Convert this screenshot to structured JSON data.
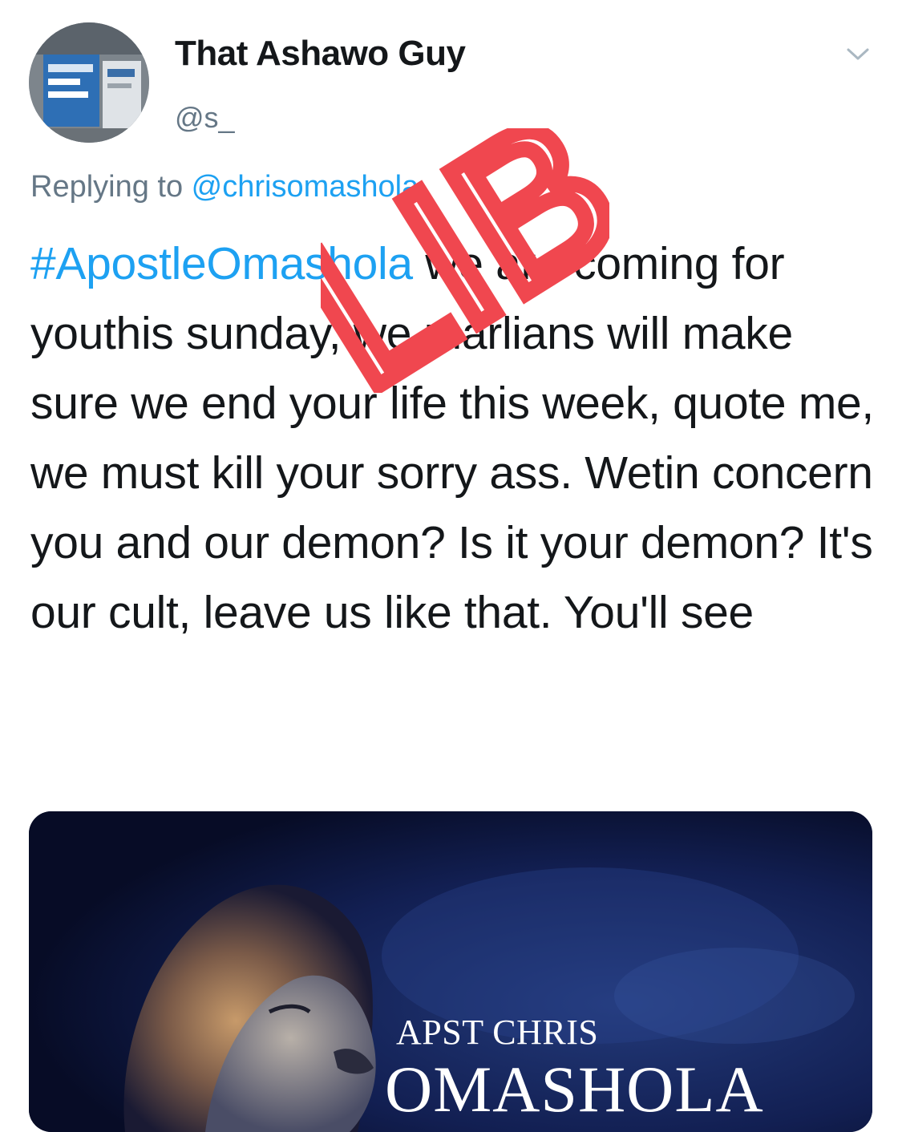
{
  "author": {
    "display_name": "That Ashawo Guy",
    "handle": "@s_",
    "avatar_icon": "profile-photo-icon"
  },
  "menu_icon": "chevron-down-icon",
  "reply": {
    "prefix": "Replying to ",
    "mention": "@chrisomashola"
  },
  "body": {
    "hashtag": "#ApostleOmashola",
    "text": " we are coming for youthis sunday, we marlians will make sure we end your life this week, quote me, we must kill your sorry ass. Wetin concern you and our demon? Is it your demon? It's our cult, leave us like that. You'll see"
  },
  "watermark": {
    "text": "LIB",
    "color": "#f0474f"
  },
  "media": {
    "subtitle": "APST CHRIS",
    "title": "OMASHOLA",
    "image_icon": "lion-image-icon"
  },
  "colors": {
    "link": "#1da1f2",
    "secondary_text": "#657786",
    "primary_text": "#14171a"
  }
}
